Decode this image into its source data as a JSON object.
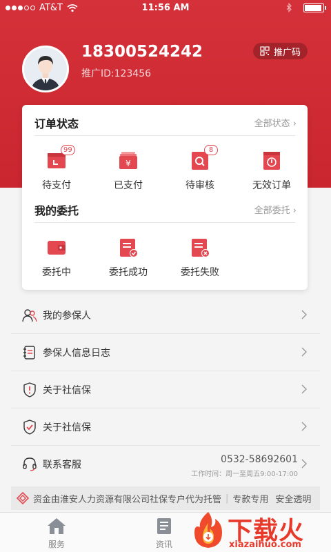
{
  "status_bar": {
    "carrier": "AT&T",
    "time": "11:56 AM"
  },
  "profile": {
    "phone": "18300524242",
    "promo_id": "推广ID:123456",
    "promo_button": "推广码"
  },
  "orders": {
    "title": "订单状态",
    "more": "全部状态",
    "items": [
      {
        "label": "待支付",
        "badge": "99",
        "icon": "wallet-clock-icon"
      },
      {
        "label": "已支付",
        "badge": "",
        "icon": "yen-card-icon"
      },
      {
        "label": "待审核",
        "badge": "8",
        "icon": "search-doc-icon"
      },
      {
        "label": "无效订单",
        "badge": "",
        "icon": "invalid-doc-icon"
      }
    ]
  },
  "entrust": {
    "title": "我的委托",
    "more": "全部委托",
    "items": [
      {
        "label": "委托中",
        "icon": "wallet-icon"
      },
      {
        "label": "委托成功",
        "icon": "doc-check-icon"
      },
      {
        "label": "委托失败",
        "icon": "doc-fail-icon"
      }
    ]
  },
  "menu": [
    {
      "label": "我的参保人",
      "icon": "people-icon"
    },
    {
      "label": "参保人信息日志",
      "icon": "log-icon"
    },
    {
      "label": "关于社信保",
      "icon": "shield-alert-icon"
    },
    {
      "label": "关于社信保",
      "icon": "shield-check-icon"
    },
    {
      "label": "联系客服",
      "icon": "headset-icon"
    }
  ],
  "contact": {
    "phone": "0532-58692601",
    "hours": "工作时间：周一至周五9:00-17:00"
  },
  "notice": {
    "text": "资金由淮安人力资源有限公司社保专户代为托管",
    "tag1": "专款专用",
    "tag2": "安全透明"
  },
  "tabs": [
    {
      "label": "服务",
      "icon": "home-icon"
    },
    {
      "label": "资讯",
      "icon": "news-icon"
    }
  ],
  "watermark": {
    "text": "下载火",
    "url": "xiazaihuo.com"
  },
  "colors": {
    "primary": "#d5313a",
    "icon_red": "#e3474f"
  }
}
